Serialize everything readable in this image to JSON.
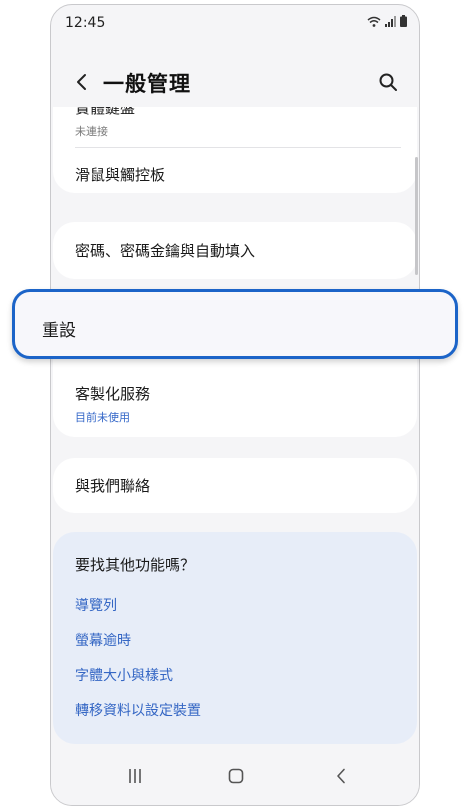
{
  "status_bar": {
    "time": "12:45",
    "icons": [
      "wifi-icon",
      "signal-icon",
      "battery-icon"
    ]
  },
  "header": {
    "back_icon": "chevron-left-icon",
    "title": "一般管理",
    "search_icon": "search-icon"
  },
  "settings": {
    "external_devices": {
      "title": "實體鍵盤",
      "subtitle": "未連接"
    },
    "mouse": {
      "title": "滑鼠與觸控板"
    },
    "passwords": {
      "title": "密碼、密碼金鑰與自動填入"
    },
    "reset": {
      "title": "重設"
    },
    "custom_service": {
      "title": "客製化服務",
      "subtitle": "目前未使用"
    },
    "contact": {
      "title": "與我們聯絡"
    }
  },
  "help": {
    "title": "要找其他功能嗎？",
    "links": [
      "導覽列",
      "螢幕逾時",
      "字體大小與樣式",
      "轉移資料以設定裝置"
    ]
  },
  "nav": {
    "recents_icon": "recents-icon",
    "home_icon": "home-icon",
    "back_icon": "back-icon"
  },
  "colors": {
    "highlight_border": "#1c64c8",
    "link": "#3466c4",
    "help_bg": "#e7edf8",
    "screen_bg": "#f5f5f7"
  }
}
